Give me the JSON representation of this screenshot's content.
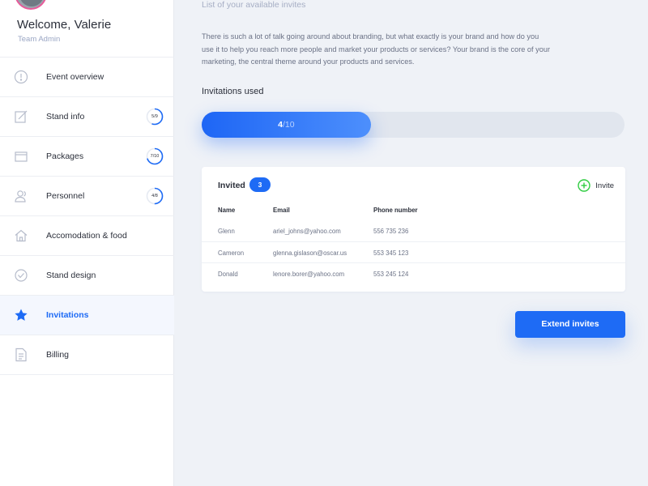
{
  "user": {
    "welcome": "Welcome, Valerie",
    "role": "Team Admin"
  },
  "sidebar": {
    "items": [
      {
        "label": "Event overview",
        "icon": "info-circle-icon"
      },
      {
        "label": "Stand info",
        "icon": "edit-icon",
        "progress": "5/9",
        "fraction": 0.556
      },
      {
        "label": "Packages",
        "icon": "package-icon",
        "progress": "7/10",
        "fraction": 0.7
      },
      {
        "label": "Personnel",
        "icon": "users-icon",
        "progress": "4/8",
        "fraction": 0.5
      },
      {
        "label": "Accomodation & food",
        "icon": "home-icon"
      },
      {
        "label": "Stand design",
        "icon": "design-icon"
      },
      {
        "label": "Invitations",
        "icon": "star-icon",
        "active": true
      },
      {
        "label": "Billing",
        "icon": "document-icon"
      }
    ]
  },
  "main": {
    "subtitle": "List of your available invites",
    "description": "There is such a lot of talk going around about branding, but what exactly is your brand and how do you use it to help you reach more people and market your products or services? Your brand is the core of your marketing, the central theme around your products and services.",
    "invitations_used_label": "Invitations used",
    "progress": {
      "used": "4",
      "total": "/10",
      "fraction": 0.4
    },
    "invited": {
      "title": "Invited",
      "count": "3",
      "invite_label": "Invite",
      "columns": [
        "Name",
        "Email",
        "Phone number"
      ],
      "rows": [
        {
          "name": "Glenn",
          "email": "ariel_johns@yahoo.com",
          "phone": "556 735 236"
        },
        {
          "name": "Cameron",
          "email": "glenna.gislason@oscar.us",
          "phone": "553 345 123"
        },
        {
          "name": "Donald",
          "email": "lenore.borer@yahoo.com",
          "phone": "553 245 124"
        }
      ]
    },
    "extend_button": "Extend invites"
  },
  "colors": {
    "accent": "#1e6bf5",
    "invite_green": "#2ecc40",
    "avatar_ring": "#e85a9a"
  }
}
